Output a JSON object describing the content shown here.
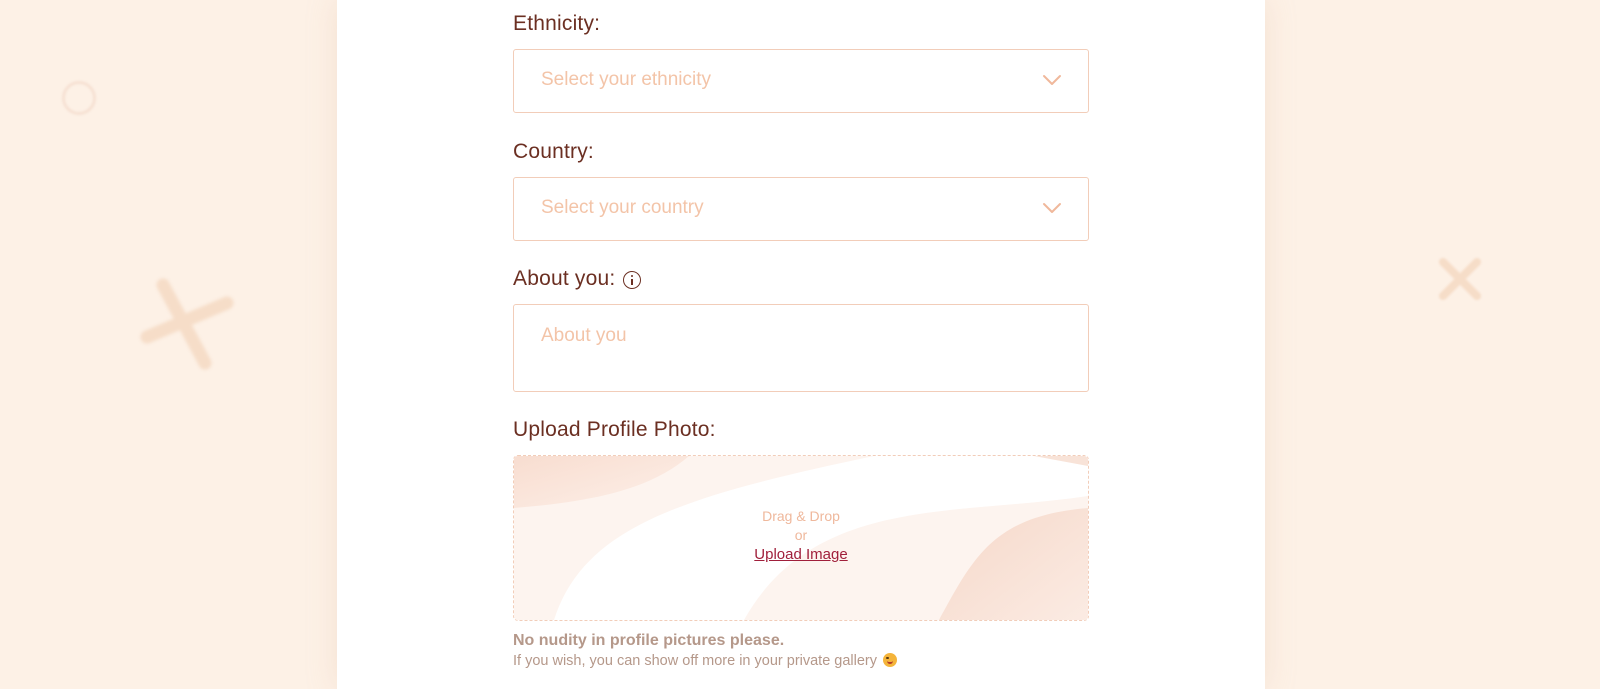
{
  "form": {
    "ethnicity": {
      "label": "Ethnicity:",
      "placeholder": "Select your ethnicity",
      "icon": "chevron-down-icon"
    },
    "country": {
      "label": "Country:",
      "placeholder": "Select your country",
      "icon": "chevron-down-icon"
    },
    "about": {
      "label": "About you:",
      "placeholder": "About you",
      "icon": "info-icon"
    },
    "photo": {
      "label": "Upload Profile Photo:",
      "drag_text": "Drag & Drop",
      "or_text": "or",
      "upload_link": "Upload Image"
    },
    "notes": {
      "warning": "No nudity in profile pictures please.",
      "hint": "If you wish, you can show off more in your private gallery",
      "emoji": "winking-face-with-tongue-icon"
    }
  },
  "colors": {
    "background": "#fdf1e6",
    "panel": "#ffffff",
    "label_text": "#6b2f22",
    "placeholder_text": "#f3c4a8",
    "field_border": "#f2cdb9",
    "link": "#a01f3b",
    "note_text": "#b5988a"
  }
}
